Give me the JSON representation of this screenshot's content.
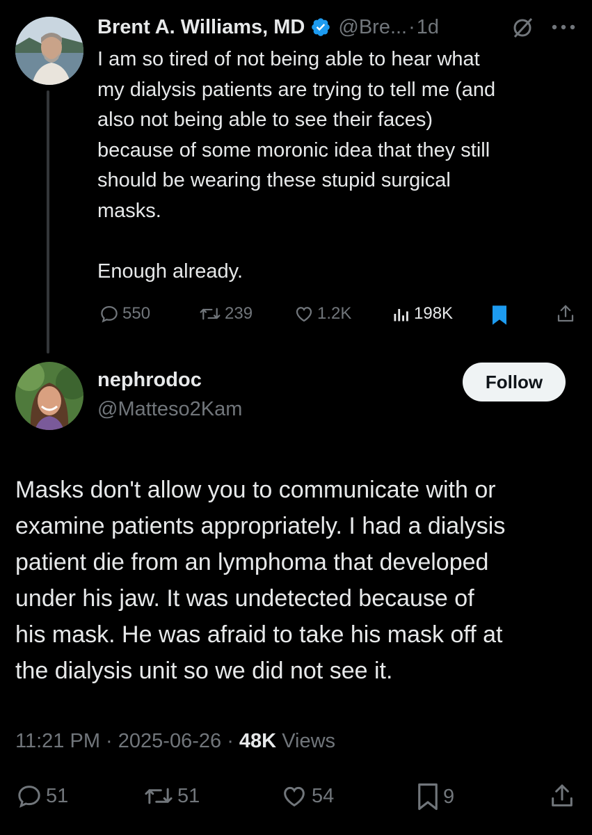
{
  "parent_tweet": {
    "author_name": "Brent A. Williams, MD",
    "handle": "@Bre...",
    "separator": "·",
    "time": "1d",
    "text": "I am so tired of not being able to hear what\nmy dialysis patients are trying to tell me (and\nalso not being able to see their faces)\nbecause of some moronic idea that they still\nshould be wearing these stupid surgical\nmasks.\n\nEnough already.",
    "stats": {
      "replies": "550",
      "reposts": "239",
      "likes": "1.2K",
      "views": "198K"
    },
    "icons": [
      "verified-badge-icon",
      "grok-icon",
      "more-icon",
      "reply-icon",
      "repost-icon",
      "like-icon",
      "views-icon",
      "bookmark-icon",
      "share-icon"
    ],
    "colors": {
      "verified": "#1d9bf0",
      "bookmark_active": "#1d9bf0"
    }
  },
  "reply_tweet": {
    "author_name": "nephrodoc",
    "handle": "@Matteso2Kam",
    "follow_label": "Follow",
    "text": "Masks don't allow you to communicate with or\nexamine patients appropriately. I had a dialysis\npatient die from an lymphoma that developed\nunder his jaw. It was undetected because of\nhis mask. He was afraid to take his mask off at\nthe dialysis unit so we did not see it.",
    "time": "11:21 PM",
    "date": "2025-06-26",
    "views_count": "48K",
    "views_label": "Views",
    "separator": "·",
    "stats": {
      "replies": "51",
      "reposts": "51",
      "likes": "54",
      "bookmarks": "9"
    }
  },
  "theme": {
    "background": "#000000",
    "text": "#e7e9ea",
    "muted": "#71767b"
  }
}
